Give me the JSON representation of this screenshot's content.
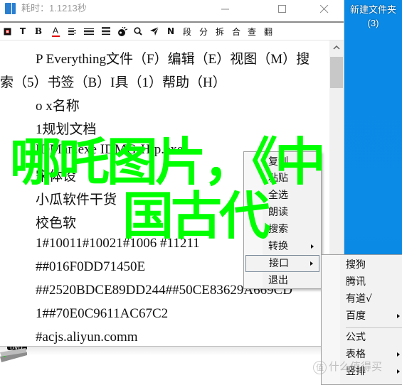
{
  "window": {
    "title": "耗时：1.1213秒",
    "controls": {
      "minimize": "minimize",
      "maximize": "maximize",
      "close": "close"
    }
  },
  "toolbar": {
    "buttons": [
      {
        "name": "stop-icon",
        "label": ""
      },
      {
        "name": "text-icon",
        "label": "T"
      },
      {
        "name": "bold-icon",
        "label": "B"
      },
      {
        "name": "font-color-icon",
        "label": "A"
      },
      {
        "name": "align-left-icon",
        "label": ""
      },
      {
        "name": "align-justify-icon",
        "label": ""
      },
      {
        "name": "align-lines-icon",
        "label": ""
      },
      {
        "name": "speaker-icon",
        "label": ""
      },
      {
        "name": "search-icon",
        "label": ""
      },
      {
        "name": "send-icon",
        "label": ""
      },
      {
        "name": "n-icon",
        "label": "N"
      },
      {
        "name": "paragraph-button",
        "label": "段"
      },
      {
        "name": "split-button",
        "label": "分"
      },
      {
        "name": "break-button",
        "label": "拆"
      },
      {
        "name": "merge-button",
        "label": "合"
      },
      {
        "name": "lookup-button",
        "label": "查"
      },
      {
        "name": "translate-button",
        "label": "翻"
      }
    ]
  },
  "document": {
    "lines": [
      "P  Everything文件（F）编辑（E）视图（M）搜",
      "索（5）书签（B）I具（1）帮助（H）",
      "o x名称",
      "1规划文档",
      "IDMan.exe IDMGrHlp.exe",
      "宋体设",
      "小瓜软件干货",
      "校色软",
      "1#10011#10021#1006 #11211",
      "##016F0DD71450E",
      "##2520BDCE89DD244##50CE83629A669CD",
      "1##70E0C9611AC67C2",
      "#acjs.aliyun.comm"
    ]
  },
  "overlay": {
    "line1": "哪吒图片，《中",
    "line2": "国古代"
  },
  "desktop": {
    "folder_label": "新建文件夹",
    "folder_count": "(3)"
  },
  "context_menu": {
    "items": [
      {
        "label": "复制",
        "submenu": false
      },
      {
        "label": "粘贴",
        "submenu": false
      },
      {
        "label": "全选",
        "submenu": false
      },
      {
        "label": "朗读",
        "submenu": false
      },
      {
        "label": "搜索",
        "submenu": false
      },
      {
        "label": "转换",
        "submenu": true
      },
      {
        "label": "接口",
        "submenu": true,
        "selected": true
      },
      {
        "label": "退出",
        "submenu": false
      }
    ]
  },
  "submenu": {
    "items": [
      {
        "label": "搜狗",
        "submenu": false
      },
      {
        "label": "腾讯",
        "submenu": false
      },
      {
        "label": "有道√",
        "submenu": false
      },
      {
        "label": "百度",
        "submenu": true
      },
      {
        "label": "公式",
        "submenu": false
      },
      {
        "label": "表格",
        "submenu": true
      },
      {
        "label": "竖排",
        "submenu": true
      }
    ]
  },
  "watermark": {
    "badge": "值",
    "text": "什么值得买"
  }
}
